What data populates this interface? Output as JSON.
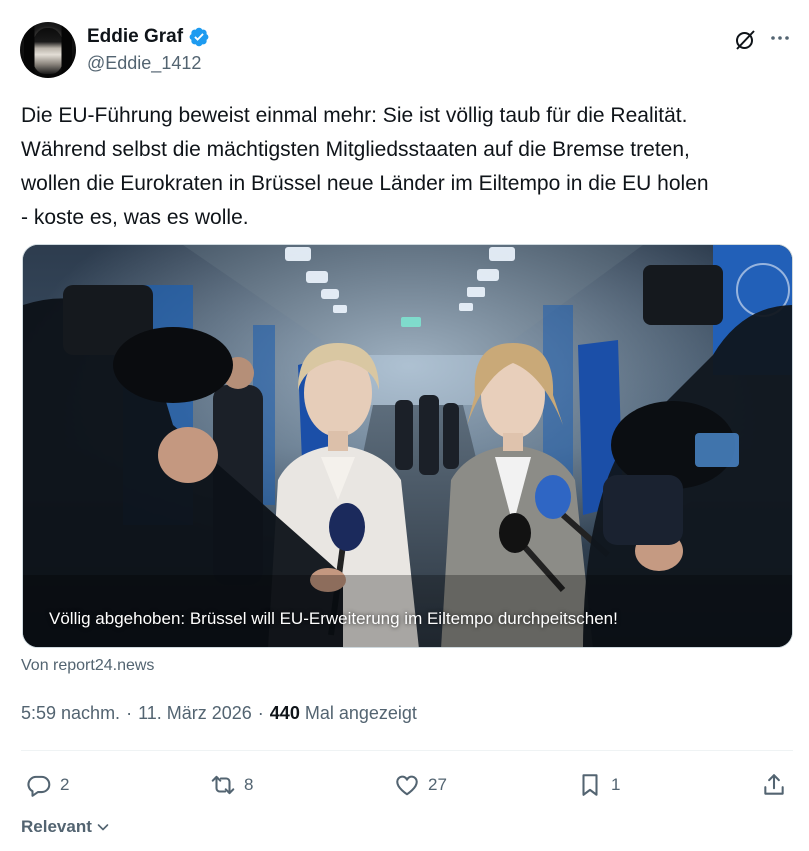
{
  "author": {
    "display_name": "Eddie Graf",
    "handle": "@Eddie_1412",
    "verified": true,
    "verified_color": "#1d9bf0"
  },
  "header_icons": [
    "grok-icon",
    "more-icon"
  ],
  "tweet": {
    "text": "Die EU-Führung beweist einmal mehr: Sie ist völlig taub für die Realität.\nWährend selbst die mächtigsten Mitgliedsstaaten auf die Bremse treten,\nwollen die Eurokraten in Brüssel neue Länder im Eiltempo in die EU holen\n- koste es, was es wolle."
  },
  "media": {
    "caption": "Völlig abgehoben: Brüssel will EU-Erweiterung im Eiltempo durchpeitschen!",
    "source": "Von report24.news"
  },
  "meta": {
    "time": "5:59 nachm.",
    "separator": "·",
    "date": "11. März 2026",
    "views_count": "440",
    "views_label": "Mal angezeigt"
  },
  "actions": {
    "reply_count": "2",
    "repost_count": "8",
    "like_count": "27",
    "bookmark_count": "1"
  },
  "sort": {
    "label": "Relevant"
  },
  "colors": {
    "text_primary": "#0f1419",
    "text_secondary": "#536471",
    "divider": "#eff3f4",
    "accent": "#1d9bf0"
  }
}
